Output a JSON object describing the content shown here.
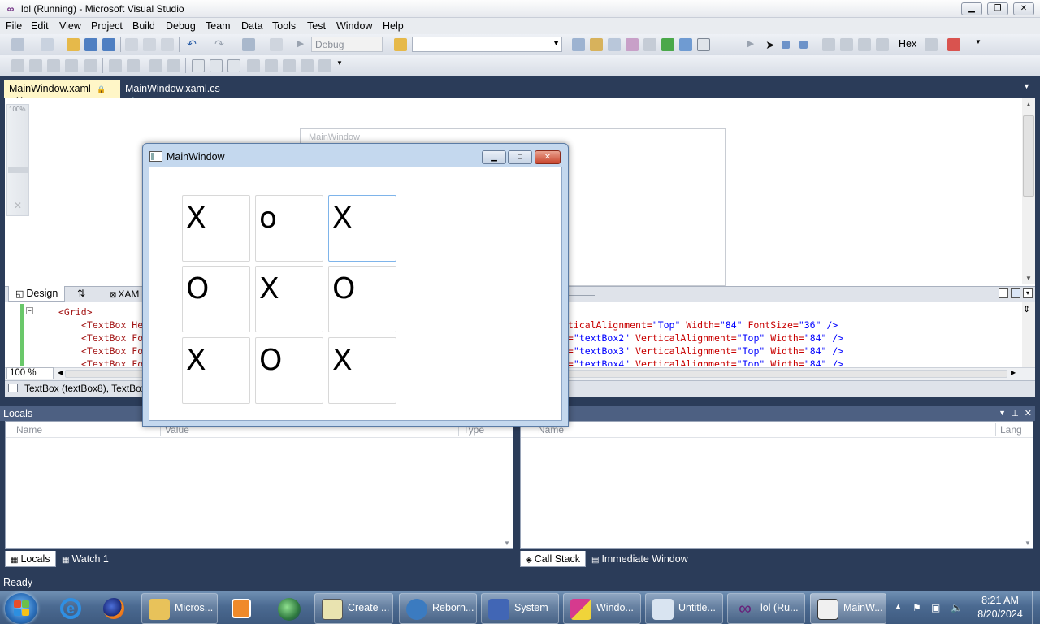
{
  "window": {
    "title": "lol (Running) - Microsoft Visual Studio",
    "minimize": "▁",
    "restore": "❐",
    "close": "✕"
  },
  "menu": [
    "File",
    "Edit",
    "View",
    "Project",
    "Build",
    "Debug",
    "Team",
    "Data",
    "Tools",
    "Test",
    "Window",
    "Help"
  ],
  "toolbar": {
    "config": "Debug",
    "hex": "Hex"
  },
  "doc_tabs": [
    {
      "label": "MainWindow.xaml",
      "active": true
    },
    {
      "label": "MainWindow.xaml.cs",
      "active": false
    }
  ],
  "designer": {
    "zoom_rail_label": "100%",
    "ghost_title": "MainWindow"
  },
  "view_tabs": {
    "design": "Design",
    "swap": "⇅",
    "xaml": "XAM"
  },
  "xaml": {
    "line1": "<Grid>",
    "left": [
      "<TextBox He",
      "<TextBox Fo",
      "<TextBox Fo",
      "<TextBox Fo"
    ],
    "right": [
      {
        "a": "rticalAlignment=",
        "v": "\"Top\"",
        "b": " Width=",
        "w": "\"84\"",
        "c": " FontSize=",
        "f": "\"36\"",
        "d": " />"
      },
      {
        "a": "e=",
        "v": "\"textBox2\"",
        "b": " VerticalAlignment=",
        "w": "\"Top\"",
        "c": " Width=",
        "f": "\"84\"",
        "d": " />"
      },
      {
        "a": "e=",
        "v": "\"textBox3\"",
        "b": " VerticalAlignment=",
        "w": "\"Top\"",
        "c": " Width=",
        "f": "\"84\"",
        "d": " />"
      },
      {
        "a": "e=",
        "v": "\"textBox4\"",
        "b": " VerticalAlignment=",
        "w": "\"Top\"",
        "c": " Width=",
        "f": "\"84\"",
        "d": " />"
      }
    ],
    "zoom": "100 %"
  },
  "breadcrumb": "TextBox (textBox8), TextBox",
  "panels": {
    "left": {
      "title": "Locals",
      "columns": [
        "Name",
        "Value",
        "Type"
      ],
      "tabs": [
        "Locals",
        "Watch 1"
      ]
    },
    "right": {
      "title": "",
      "columns": [
        "Name",
        "Lang"
      ],
      "tabs": [
        "Call Stack",
        "Immediate Window"
      ]
    }
  },
  "status": "Ready",
  "app": {
    "title": "MainWindow",
    "cells": [
      "X",
      "o",
      "X",
      "O",
      "X",
      "O",
      "X",
      "O",
      "X"
    ]
  },
  "taskbar": {
    "items": [
      {
        "label": "Micros...",
        "color": "#e8c25a"
      },
      {
        "label": "Create ...",
        "color": "#e9e3b0"
      },
      {
        "label": "Reborn...",
        "color": "#3b7bc0"
      },
      {
        "label": "System",
        "color": "#4166b5"
      },
      {
        "label": "Windo...",
        "color": "#d63a8e"
      },
      {
        "label": "Untitle...",
        "color": "#d9e4f1"
      },
      {
        "label": "lol (Ru...",
        "color": "#68217a"
      },
      {
        "label": "MainW...",
        "color": "#f0f0f0"
      }
    ],
    "time": "8:21 AM",
    "date": "8/20/2024"
  }
}
